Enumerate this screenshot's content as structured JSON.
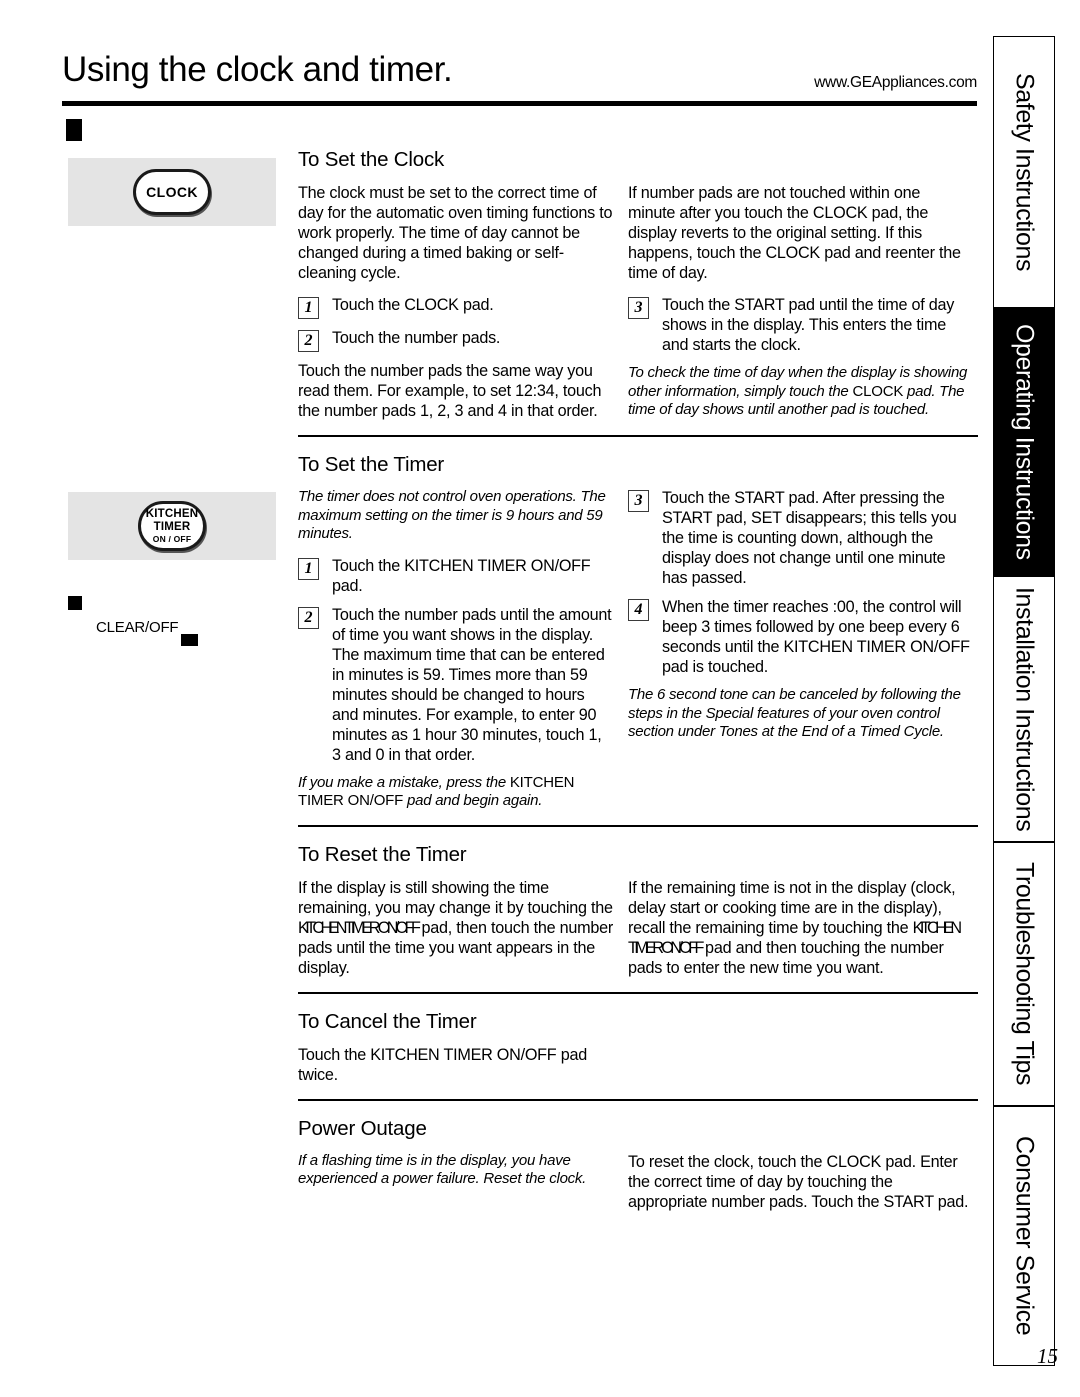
{
  "header": {
    "title": "Using the clock and timer.",
    "url": "www.GEAppliances.com"
  },
  "left_panel": {
    "clock_pad_label": "CLOCK",
    "timer_pad_line1": "KITCHEN",
    "timer_pad_line2": "TIMER",
    "timer_pad_line3": "ON / OFF",
    "clear_off_label": "CLEAR/OFF"
  },
  "sections": [
    {
      "id": "set-clock",
      "title": "To Set the Clock",
      "left": {
        "intro": "The clock must be set to the correct time of day for the automatic oven timing functions to work properly. The time of day cannot be changed during a timed baking or self-cleaning cycle.",
        "steps": [
          {
            "num": "1",
            "text": "Touch the CLOCK pad."
          },
          {
            "num": "2",
            "text": "Touch the number pads."
          }
        ],
        "outro": "Touch the number pads the same way you read them. For example, to set 12:34, touch the number pads 1, 2, 3 and 4 in that order."
      },
      "right": {
        "intro": "If number pads are not touched within one minute after you touch the CLOCK pad, the display reverts to the original setting. If this happens, touch the CLOCK pad and reenter the time of day.",
        "steps": [
          {
            "num": "3",
            "text": "Touch the START pad until the time of day shows in the display. This enters the time and starts the clock."
          }
        ],
        "note_a": "To check the time of day when the display is showing other information, simply touch the ",
        "note_caps": "CLOCK",
        "note_b": " pad. The time of day shows until another pad is touched."
      }
    },
    {
      "id": "set-timer",
      "title": "To Set the Timer",
      "left": {
        "intro_italic": "The timer does not control oven operations. The maximum setting on the timer is 9 hours and 59 minutes.",
        "steps": [
          {
            "num": "1",
            "text": "Touch the KITCHEN TIMER ON/OFF pad."
          },
          {
            "num": "2",
            "text": "Touch the number pads until the amount of time you want shows in the display. The maximum time that can be entered in minutes is 59. Times more than 59 minutes should be changed to hours and minutes. For example, to enter 90 minutes as 1 hour 30 minutes, touch 1, 3 and 0 in that order."
          }
        ],
        "note_a": "If you make a mistake, press the ",
        "note_caps": "KITCHEN TIMER ON/OFF",
        "note_b": " pad and begin again."
      },
      "right": {
        "steps": [
          {
            "num": "3",
            "text": "Touch the START pad. After pressing the START pad, SET disappears; this tells you the time is counting down, although the display does not change until one minute has passed."
          },
          {
            "num": "4",
            "text": "When the timer reaches :00, the control will beep 3 times followed by one beep every 6 seconds until the KITCHEN TIMER ON/OFF pad is touched."
          }
        ],
        "note": "The 6 second tone can be canceled by following the steps in the Special features of your oven control section under Tones at the End of a Timed Cycle."
      }
    },
    {
      "id": "reset-timer",
      "title": "To Reset the Timer",
      "left": {
        "body_a": "If the display is still showing the time remaining, you may change it by touching the ",
        "body_caps": "KITCHEN TIMER ON/OFF",
        "body_b": " pad, then touch the number pads until the time you want appears in the display."
      },
      "right": {
        "body_a": "If the remaining time is not in the display (clock, delay start or cooking time are in the display), recall the remaining time by touching the ",
        "body_caps": "KITCHEN TIMER ON/OFF",
        "body_b": " pad and then touching the number pads to enter the new time you want."
      }
    },
    {
      "id": "cancel-timer",
      "title": "To Cancel the Timer",
      "left": {
        "body": "Touch the KITCHEN TIMER ON/OFF pad twice."
      }
    },
    {
      "id": "power-outage",
      "title": "Power Outage",
      "left": {
        "body_italic": "If a flashing time is in the display, you have experienced a power failure. Reset the clock."
      },
      "right": {
        "body": "To reset the clock, touch the CLOCK pad. Enter the correct time of day by touching the appropriate number pads. Touch the START pad."
      }
    }
  ],
  "sidebar": {
    "tabs": [
      {
        "label": "Safety Instructions",
        "dark": false
      },
      {
        "label": "Operating Instructions",
        "dark": true
      },
      {
        "label": "Installation Instructions",
        "dark": false
      },
      {
        "label": "Troubleshooting Tips",
        "dark": false
      },
      {
        "label": "Consumer Service",
        "dark": false
      }
    ]
  },
  "page_number": "15",
  "colors": {
    "ink": "#000000",
    "panel_gray": "#e4e4e4"
  }
}
